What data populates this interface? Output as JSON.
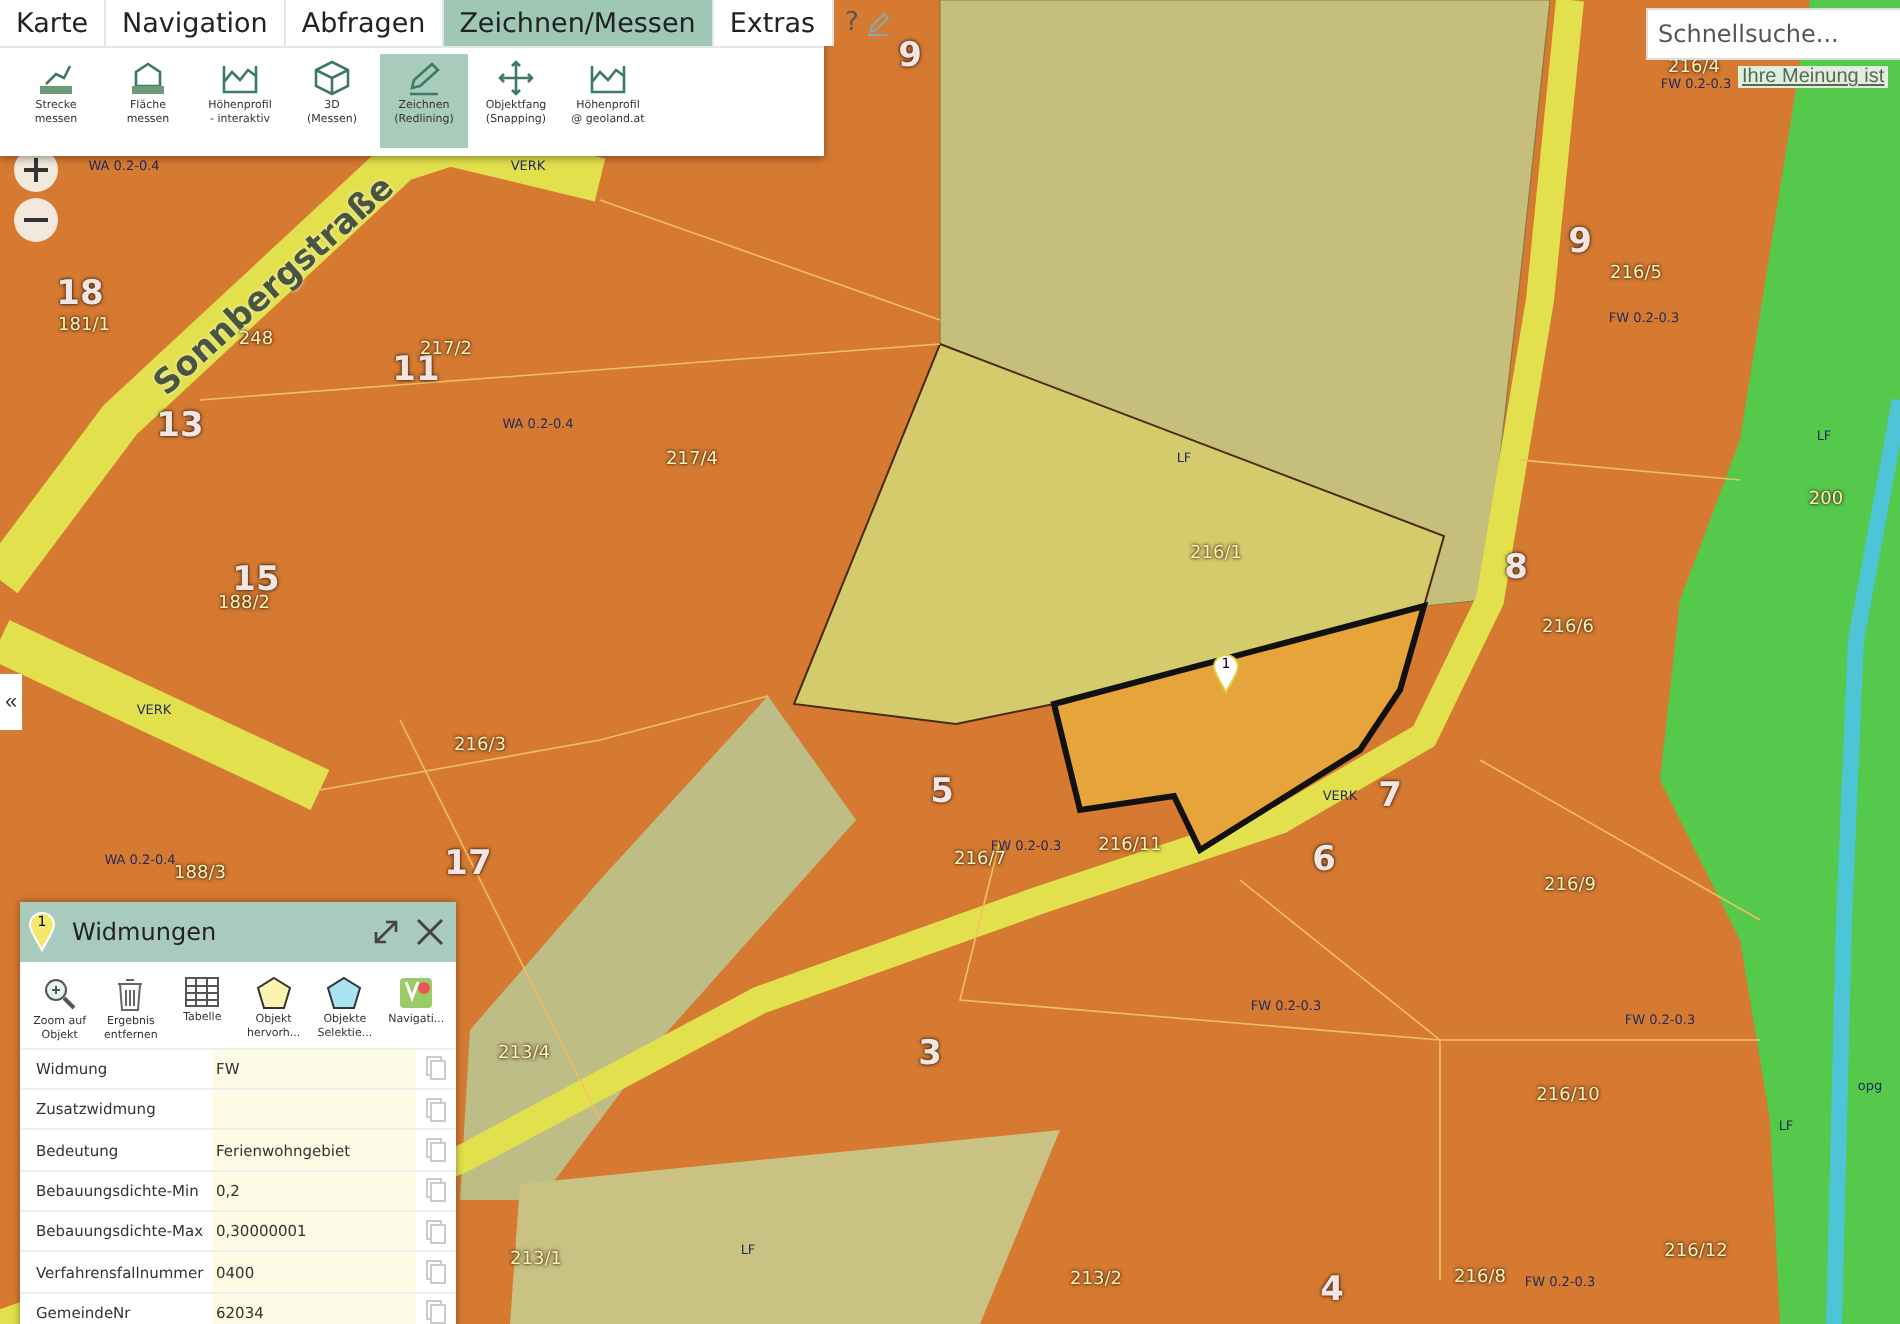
{
  "menu": {
    "tabs": [
      {
        "label": "Karte",
        "selected": false
      },
      {
        "label": "Navigation",
        "selected": false
      },
      {
        "label": "Abfragen",
        "selected": false
      },
      {
        "label": "Zeichnen/Messen",
        "selected": true
      },
      {
        "label": "Extras",
        "selected": false
      }
    ],
    "help": "?"
  },
  "tools": [
    {
      "kind": "line",
      "label": "Strecke\nmessen",
      "selected": false
    },
    {
      "kind": "area",
      "label": "Fläche\nmessen",
      "selected": false
    },
    {
      "kind": "profile",
      "label": "Höhenprofil\n- interaktiv",
      "selected": false
    },
    {
      "kind": "cube",
      "label": "3D\n(Messen)",
      "selected": false
    },
    {
      "kind": "pencil",
      "label": "Zeichnen\n(Redlining)",
      "selected": true
    },
    {
      "kind": "move",
      "label": "Objektfang\n(Snapping)",
      "selected": false
    },
    {
      "kind": "profile",
      "label": "Höhenprofil\n@ geoland.at",
      "selected": false
    }
  ],
  "search": {
    "placeholder": "Schnellsuche..."
  },
  "feedback_link": "Ihre Meinung ist",
  "collapse": "«",
  "map": {
    "street_name": "Sonnbergstraße",
    "marker": "1",
    "labels": [
      {
        "kind": "house",
        "text": "9"
      },
      {
        "kind": "house",
        "text": "18"
      },
      {
        "kind": "house",
        "text": "11"
      },
      {
        "kind": "house",
        "text": "13"
      },
      {
        "kind": "house",
        "text": "15"
      },
      {
        "kind": "house",
        "text": "17"
      },
      {
        "kind": "house",
        "text": "5"
      },
      {
        "kind": "house",
        "text": "7"
      },
      {
        "kind": "house",
        "text": "6"
      },
      {
        "kind": "house",
        "text": "3"
      },
      {
        "kind": "house",
        "text": "4"
      },
      {
        "kind": "house",
        "text": "9"
      },
      {
        "kind": "house",
        "text": "8"
      },
      {
        "kind": "parcel",
        "text": "181/1"
      },
      {
        "kind": "parcel",
        "text": "248"
      },
      {
        "kind": "parcel",
        "text": "217/2"
      },
      {
        "kind": "parcel",
        "text": "217/4"
      },
      {
        "kind": "parcel",
        "text": "188/2"
      },
      {
        "kind": "parcel",
        "text": "216/3"
      },
      {
        "kind": "parcel",
        "text": "188/3"
      },
      {
        "kind": "parcel",
        "text": "216/1"
      },
      {
        "kind": "parcel",
        "text": "216/7"
      },
      {
        "kind": "parcel",
        "text": "216/11"
      },
      {
        "kind": "parcel",
        "text": "216/4"
      },
      {
        "kind": "parcel",
        "text": "216/5"
      },
      {
        "kind": "parcel",
        "text": "216/6"
      },
      {
        "kind": "parcel",
        "text": "216/9"
      },
      {
        "kind": "parcel",
        "text": "216/10"
      },
      {
        "kind": "parcel",
        "text": "216/12"
      },
      {
        "kind": "parcel",
        "text": "213/2"
      },
      {
        "kind": "parcel",
        "text": "216/8"
      },
      {
        "kind": "parcel",
        "text": "213/4"
      },
      {
        "kind": "parcel",
        "text": "213/1"
      },
      {
        "kind": "parcel",
        "text": "200"
      },
      {
        "kind": "zoning",
        "text": "WA 0.2-0.4"
      },
      {
        "kind": "zoning",
        "text": "WA 0.2-0.4"
      },
      {
        "kind": "zoning",
        "text": "WA 0.2-0.4"
      },
      {
        "kind": "zoning",
        "text": "FW 0.2-0.3"
      },
      {
        "kind": "zoning",
        "text": "FW 0.2-0.3"
      },
      {
        "kind": "zoning",
        "text": "FW 0.2-0.3"
      },
      {
        "kind": "zoning",
        "text": "FW 0.2-0.3"
      },
      {
        "kind": "zoning",
        "text": "FW 0.2-0.3"
      },
      {
        "kind": "zoning",
        "text": "FW 0.2-0.3"
      },
      {
        "kind": "zoning",
        "text": "LF"
      },
      {
        "kind": "zoning",
        "text": "LF"
      },
      {
        "kind": "zoning",
        "text": "LF"
      },
      {
        "kind": "zoning",
        "text": "LF"
      },
      {
        "kind": "zoning",
        "text": "VERK"
      },
      {
        "kind": "zoning",
        "text": "VERK"
      },
      {
        "kind": "zoning",
        "text": "VERK"
      },
      {
        "kind": "zoning",
        "text": "opg"
      }
    ]
  },
  "panel": {
    "title": "Widmungen",
    "marker": "1",
    "actions": [
      {
        "kind": "zoom",
        "label": "Zoom auf\nObjekt"
      },
      {
        "kind": "trash",
        "label": "Ergebnis\nentfernen"
      },
      {
        "kind": "table",
        "label": "Tabelle"
      },
      {
        "kind": "highlight",
        "label": "Objekt\nhervorh..."
      },
      {
        "kind": "select",
        "label": "Objekte\nSelektie..."
      },
      {
        "kind": "nav",
        "label": "Navigati..."
      }
    ],
    "rows": [
      {
        "label": "Widmung",
        "value": "FW"
      },
      {
        "label": "Zusatzwidmung",
        "value": ""
      },
      {
        "label": "Bedeutung",
        "value": "Ferienwohngebiet"
      },
      {
        "label": "Bebauungsdichte-Min",
        "value": "0,2"
      },
      {
        "label": "Bebauungsdichte-Max",
        "value": "0,30000001"
      },
      {
        "label": "Verfahrensfallnummer",
        "value": "0400"
      },
      {
        "label": "GemeindeNr",
        "value": "62034"
      }
    ]
  }
}
